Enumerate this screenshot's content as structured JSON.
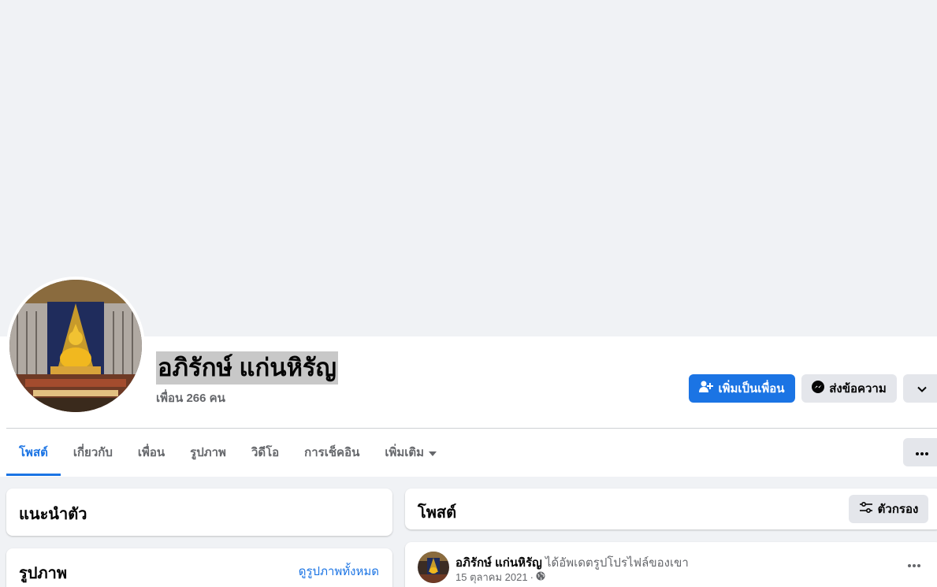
{
  "profile": {
    "name": "อภิรักษ์ แก่นหิรัญ",
    "friends_count": "เพื่อน 266 คน"
  },
  "actions": {
    "add_friend": "เพิ่มเป็นเพื่อน",
    "message": "ส่งข้อความ"
  },
  "tabs": [
    {
      "label": "โพสต์"
    },
    {
      "label": "เกี่ยวกับ"
    },
    {
      "label": "เพื่อน"
    },
    {
      "label": "รูปภาพ"
    },
    {
      "label": "วิดีโอ"
    },
    {
      "label": "การเช็คอิน"
    },
    {
      "label": "เพิ่มเติม"
    }
  ],
  "intro": {
    "title": "แนะนำตัว"
  },
  "photos": {
    "title": "รูปภาพ",
    "see_all": "ดูรูปภาพทั้งหมด"
  },
  "posts": {
    "title": "โพสต์",
    "filter_label": "ตัวกรอง",
    "items": [
      {
        "author": "อภิรักษ์ แก่นหิรัญ",
        "action": "ได้อัพเดตรูปโปรไฟล์ของเขา",
        "date": "15 ตุลาคม 2021",
        "separator": "·"
      }
    ]
  },
  "colors": {
    "accent": "#1b74e4",
    "page_bg": "#f0f2f5",
    "secondary_button": "#e4e6eb",
    "muted_text": "#65676b"
  },
  "icons": [
    "add-friend-icon",
    "messenger-icon",
    "chevron-down-icon",
    "caret-down-icon",
    "more-dots-icon",
    "filter-icon",
    "globe-icon"
  ]
}
